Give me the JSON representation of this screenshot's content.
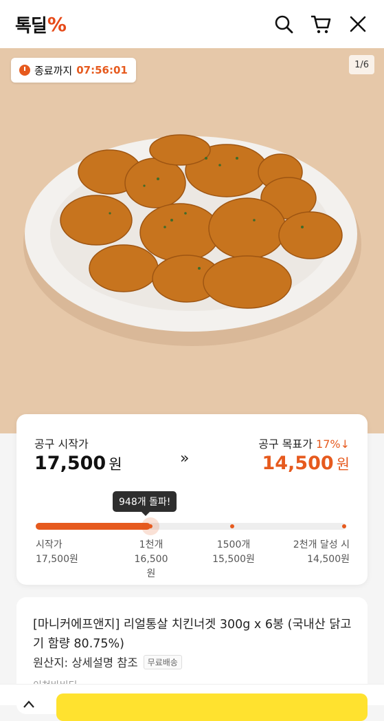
{
  "header": {
    "logo": "톡딜",
    "logo_mark": "%",
    "icons": [
      "search-icon",
      "cart-icon",
      "close-icon"
    ]
  },
  "hero": {
    "timer_label": "종료까지",
    "timer_value": "07:56:01",
    "image_counter": "1/6"
  },
  "deal": {
    "start_label": "공구 시작가",
    "start_price": "17,500",
    "currency": "원",
    "target_label": "공구 목표가",
    "discount": "17%↓",
    "target_price": "14,500",
    "arrow": "»",
    "tooltip": "948개 돌파!",
    "progress_fraction": 0.37,
    "milestones": [
      {
        "label": "시작가",
        "price": "17,500원"
      },
      {
        "label": "1천개",
        "price": "16,500원"
      },
      {
        "label": "1500개",
        "price": "15,500원"
      },
      {
        "label": "2천개 달성 시",
        "price": "14,500원"
      }
    ]
  },
  "product": {
    "title": "[마니커에프앤지] 리얼통살 치킨너겟 300g x 6봉 (국내산 닭고기 함량 80.75%)",
    "origin": "원산지: 상세설명 참조",
    "badge": "무료배송",
    "partial_text": "이천바비티"
  },
  "colors": {
    "accent": "#e65a1e",
    "buy_button": "#ffe22f"
  }
}
